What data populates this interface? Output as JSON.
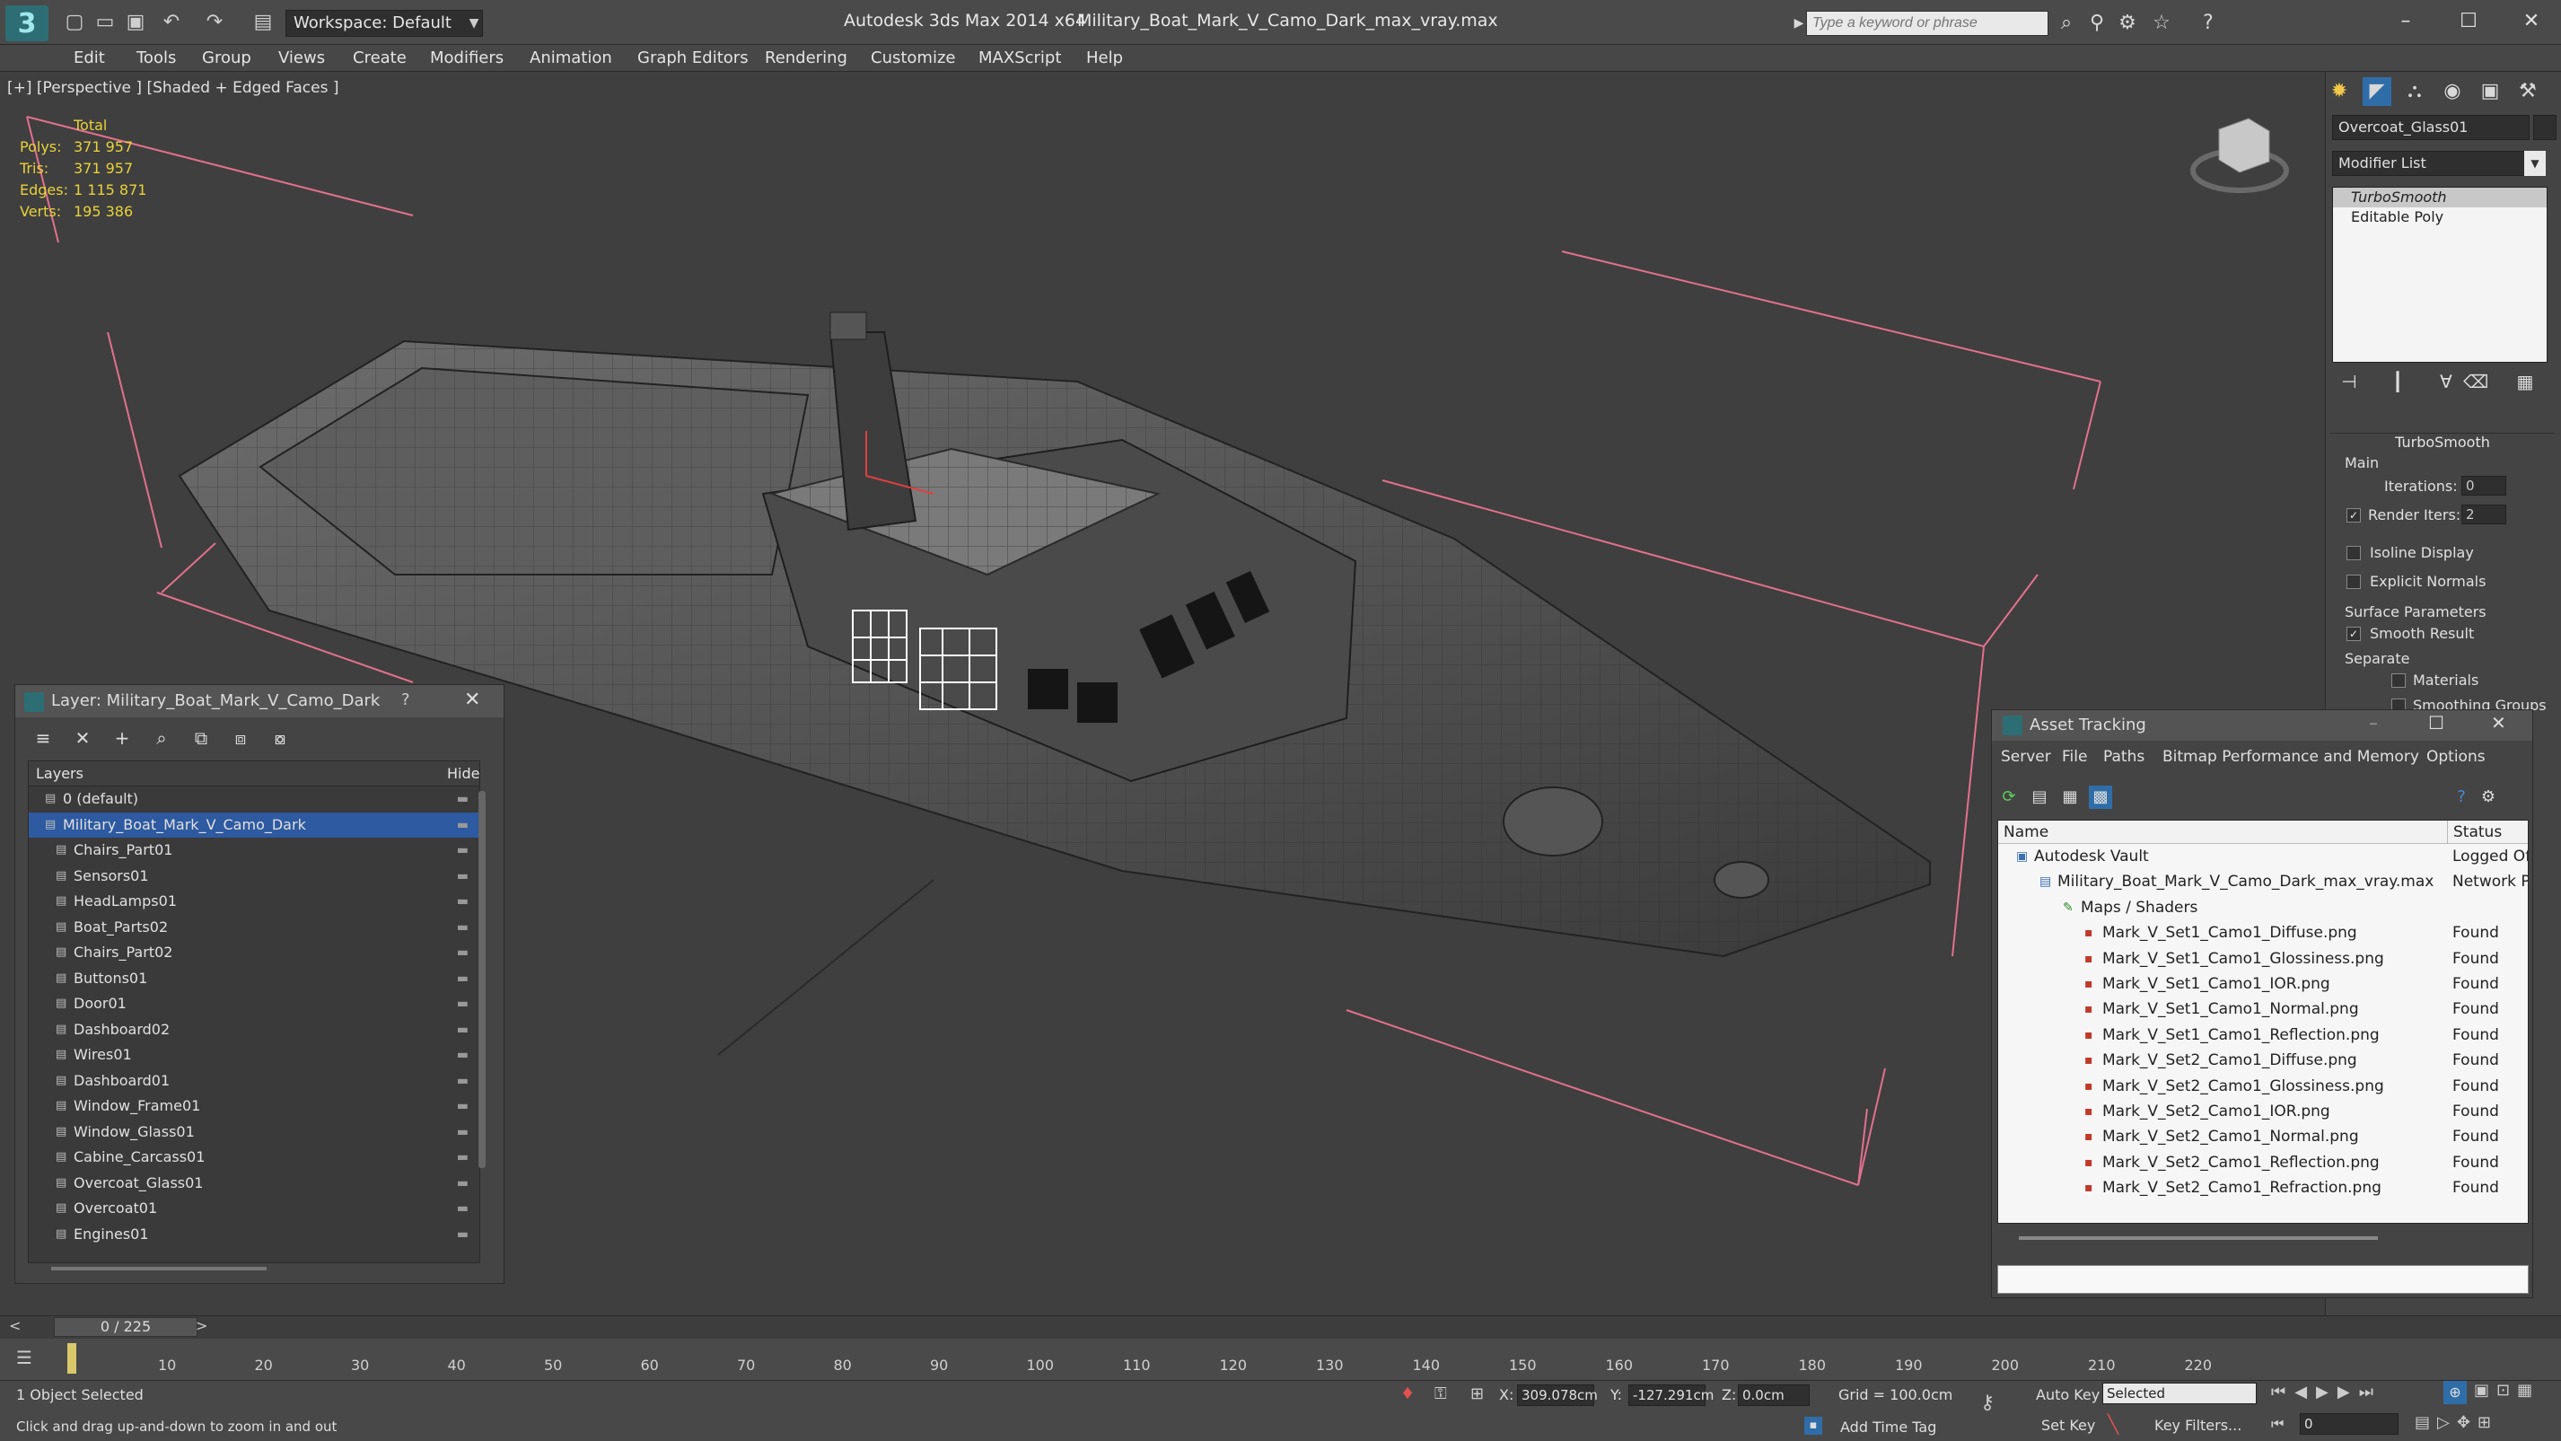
{
  "titlebar": {
    "logo": "3",
    "workspace": "Workspace: Default",
    "app_title": "Autodesk 3ds Max  2014 x64",
    "file_title": "Military_Boat_Mark_V_Camo_Dark_max_vray.max",
    "search_placeholder": "Type a keyword or phrase",
    "minimize": "–",
    "maximize": "☐",
    "close": "✕"
  },
  "menu": [
    "Edit",
    "Tools",
    "Group",
    "Views",
    "Create",
    "Modifiers",
    "Animation",
    "Graph Editors",
    "Rendering",
    "Customize",
    "MAXScript",
    "Help"
  ],
  "viewport": {
    "label": "[+] [Perspective ] [Shaded + Edged Faces ]",
    "stats": {
      "header": "Total",
      "rows": [
        {
          "label": "Polys:",
          "value": "371 957"
        },
        {
          "label": "Tris:",
          "value": "371 957"
        },
        {
          "label": "Edges:",
          "value": "1 115 871"
        },
        {
          "label": "Verts:",
          "value": "195 386"
        }
      ]
    }
  },
  "command_panel": {
    "object_name": "Overcoat_Glass01",
    "modifier_list": "Modifier List",
    "stack": [
      "TurboSmooth",
      "Editable Poly"
    ],
    "rollout": "TurboSmooth",
    "main_group": "Main",
    "iterations_label": "Iterations:",
    "iterations_value": "0",
    "render_iters_label": "Render Iters:",
    "render_iters_value": "2",
    "isoline": "Isoline Display",
    "explicit": "Explicit Normals",
    "surface_params": "Surface Parameters",
    "smooth_result": "Smooth Result",
    "separate": "Separate",
    "materials": "Materials",
    "smoothing_groups": "Smoothing Groups"
  },
  "layer_window": {
    "title": "Layer: Military_Boat_Mark_V_Camo_Dark",
    "help": "?",
    "close": "✕",
    "col_layers": "Layers",
    "col_hide": "Hide",
    "rows": [
      {
        "name": "0 (default)",
        "level": 1
      },
      {
        "name": "Military_Boat_Mark_V_Camo_Dark",
        "level": 1,
        "selected": true
      },
      {
        "name": "Chairs_Part01",
        "level": 2
      },
      {
        "name": "Sensors01",
        "level": 2
      },
      {
        "name": "HeadLamps01",
        "level": 2
      },
      {
        "name": "Boat_Parts02",
        "level": 2
      },
      {
        "name": "Chairs_Part02",
        "level": 2
      },
      {
        "name": "Buttons01",
        "level": 2
      },
      {
        "name": "Door01",
        "level": 2
      },
      {
        "name": "Dashboard02",
        "level": 2
      },
      {
        "name": "Wires01",
        "level": 2
      },
      {
        "name": "Dashboard01",
        "level": 2
      },
      {
        "name": "Window_Frame01",
        "level": 2
      },
      {
        "name": "Window_Glass01",
        "level": 2
      },
      {
        "name": "Cabine_Carcass01",
        "level": 2
      },
      {
        "name": "Overcoat_Glass01",
        "level": 2
      },
      {
        "name": "Overcoat01",
        "level": 2
      },
      {
        "name": "Engines01",
        "level": 2
      }
    ]
  },
  "asset_tracking": {
    "title": "Asset Tracking",
    "menu": [
      "Server",
      "File",
      "Paths",
      "Bitmap Performance and Memory",
      "Options"
    ],
    "col_name": "Name",
    "col_status": "Status",
    "rows": [
      {
        "name": "Autodesk Vault",
        "status": "Logged Of",
        "indent": 20
      },
      {
        "name": "Military_Boat_Mark_V_Camo_Dark_max_vray.max",
        "status": "Network P",
        "indent": 46
      },
      {
        "name": "Maps / Shaders",
        "status": "",
        "indent": 72
      },
      {
        "name": "Mark_V_Set1_Camo1_Diffuse.png",
        "status": "Found",
        "indent": 96
      },
      {
        "name": "Mark_V_Set1_Camo1_Glossiness.png",
        "status": "Found",
        "indent": 96
      },
      {
        "name": "Mark_V_Set1_Camo1_IOR.png",
        "status": "Found",
        "indent": 96
      },
      {
        "name": "Mark_V_Set1_Camo1_Normal.png",
        "status": "Found",
        "indent": 96
      },
      {
        "name": "Mark_V_Set1_Camo1_Reflection.png",
        "status": "Found",
        "indent": 96
      },
      {
        "name": "Mark_V_Set2_Camo1_Diffuse.png",
        "status": "Found",
        "indent": 96
      },
      {
        "name": "Mark_V_Set2_Camo1_Glossiness.png",
        "status": "Found",
        "indent": 96
      },
      {
        "name": "Mark_V_Set2_Camo1_IOR.png",
        "status": "Found",
        "indent": 96
      },
      {
        "name": "Mark_V_Set2_Camo1_Normal.png",
        "status": "Found",
        "indent": 96
      },
      {
        "name": "Mark_V_Set2_Camo1_Reflection.png",
        "status": "Found",
        "indent": 96
      },
      {
        "name": "Mark_V_Set2_Camo1_Refraction.png",
        "status": "Found",
        "indent": 96
      }
    ]
  },
  "timeline": {
    "frame": "0 / 225",
    "ticks": [
      "10",
      "20",
      "30",
      "40",
      "50",
      "60",
      "70",
      "80",
      "90",
      "100",
      "110",
      "120",
      "130",
      "140",
      "150",
      "160",
      "170",
      "180",
      "190",
      "200",
      "210",
      "220"
    ]
  },
  "status": {
    "selected": "1 Object Selected",
    "hint": "Click and drag up-and-down to zoom in and out",
    "x_label": "X:",
    "x_value": "309.078cm",
    "y_label": "Y:",
    "y_value": "-127.291cm",
    "z_label": "Z:",
    "z_value": "0.0cm",
    "grid": "Grid = 100.0cm",
    "auto_key": "Auto Key",
    "set_key": "Set Key",
    "selected_dropdown": "Selected",
    "key_filters": "Key Filters...",
    "add_time_tag": "Add Time Tag",
    "frame_field": "0"
  }
}
